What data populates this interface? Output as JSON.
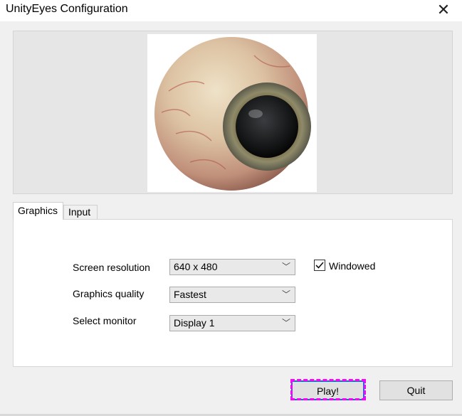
{
  "window": {
    "title": "UnityEyes Configuration",
    "close_glyph": "✕"
  },
  "tabs": [
    {
      "label": "Graphics",
      "active": true
    },
    {
      "label": "Input",
      "active": false
    }
  ],
  "graphics": {
    "resolution_label": "Screen resolution",
    "resolution_value": "640 x 480",
    "quality_label": "Graphics quality",
    "quality_value": "Fastest",
    "monitor_label": "Select monitor",
    "monitor_value": "Display 1",
    "windowed_label": "Windowed",
    "windowed_checked": true
  },
  "buttons": {
    "play_label": "Play!",
    "quit_label": "Quit"
  },
  "icons": {
    "banner": "eyeball-image",
    "dropdown": "chevron-down-icon",
    "close": "close-icon",
    "check": "checkmark-icon"
  },
  "colors": {
    "focus_border": "#0078d7",
    "highlight": "#ff00ff"
  }
}
